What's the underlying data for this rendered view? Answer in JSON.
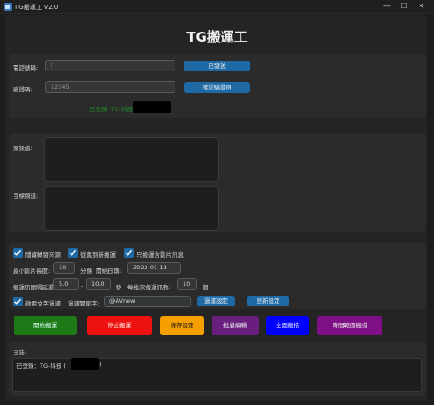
{
  "window": {
    "title": "TG搬運工 v2.0",
    "minimize": "—",
    "maximize": "☐",
    "close": "✕"
  },
  "app_title": "TG搬運工",
  "login": {
    "phone_label": "電話號碼:",
    "phone_value": "|",
    "send_code_button": "已發送",
    "code_label": "驗證碼:",
    "code_placeholder": "12345",
    "confirm_code_button": "確認驗證碼",
    "status_text": "已登錄: TG-科技"
  },
  "channels": {
    "source_label": "源頻道:",
    "target_label": "目標頻道:"
  },
  "options": {
    "hide_forward_label": "隱藏轉發來源",
    "from_new_label": "從舊到新搬運",
    "media_only_label": "只搬運含影片訊息",
    "min_video_label": "最小影片長度:",
    "min_video_value": "10",
    "min_video_unit": "分鐘",
    "start_date_label": "開始日期:",
    "start_date_value": "2022-01-13",
    "interval_label": "搬運訊間隔延遲:",
    "interval_min": "5.0",
    "interval_dash": "-",
    "interval_max": "10.0",
    "interval_unit": "秒",
    "batch_label": "每批次搬運訊數:",
    "batch_value": "10",
    "batch_unit": "個",
    "text_filter_label": "啟用文字過濾",
    "filter_keyword_label": "過濾關鍵字:",
    "filter_keyword_value": "@AVnew",
    "filter_settings_button": "過濾設定",
    "replace_settings_button": "更新設定"
  },
  "actions": {
    "start": "開始搬運",
    "stop": "停止搬運",
    "save": "保存設定",
    "batch_edit": "批量編輯",
    "full_media": "全面搬描",
    "scheduled": "時間範圍搬描"
  },
  "log": {
    "label": "日誌:",
    "line1": "已登錄：TG-科技 (",
    "line1_end": ")"
  },
  "colors": {
    "accent_blue": "#1f6aa5",
    "start_green": "#1e7a16",
    "stop_red": "#ee1111",
    "save_orange": "#f5a000",
    "batch_purple": "#6a1f7e",
    "full_blue": "#0000ff",
    "sched_purple": "#7e0f86",
    "status_green": "#1e8a2a"
  }
}
